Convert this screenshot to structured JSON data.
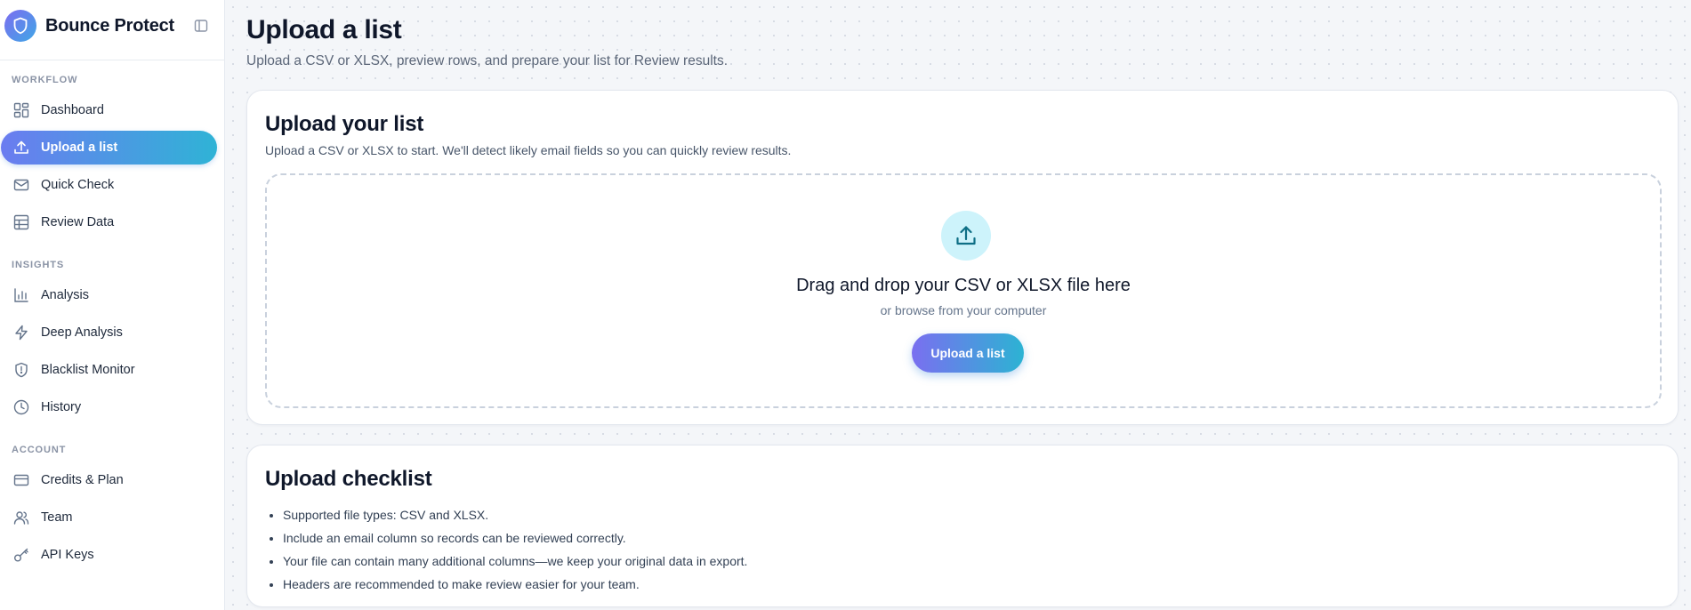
{
  "brand": {
    "name": "Bounce Protect"
  },
  "sidebar": {
    "sections": [
      {
        "label": "WORKFLOW",
        "items": [
          {
            "label": "Dashboard",
            "icon": "dashboard-icon"
          },
          {
            "label": "Upload a list",
            "icon": "upload-icon",
            "active": true
          },
          {
            "label": "Quick Check",
            "icon": "mail-icon"
          },
          {
            "label": "Review Data",
            "icon": "table-icon"
          }
        ]
      },
      {
        "label": "INSIGHTS",
        "items": [
          {
            "label": "Analysis",
            "icon": "bar-chart-icon"
          },
          {
            "label": "Deep Analysis",
            "icon": "lightning-icon"
          },
          {
            "label": "Blacklist Monitor",
            "icon": "shield-alert-icon"
          },
          {
            "label": "History",
            "icon": "clock-icon"
          }
        ]
      },
      {
        "label": "ACCOUNT",
        "items": [
          {
            "label": "Credits & Plan",
            "icon": "credit-card-icon"
          },
          {
            "label": "Team",
            "icon": "users-icon"
          },
          {
            "label": "API Keys",
            "icon": "key-icon"
          }
        ]
      }
    ]
  },
  "page": {
    "title": "Upload a list",
    "subtitle": "Upload a CSV or XLSX, preview rows, and prepare your list for Review results."
  },
  "upload_card": {
    "title": "Upload your list",
    "description": "Upload a CSV or XLSX to start. We'll detect likely email fields so you can quickly review results.",
    "dropzone": {
      "title": "Drag and drop your CSV or XLSX file here",
      "subtitle": "or browse from your computer",
      "button_label": "Upload a list"
    }
  },
  "checklist_card": {
    "title": "Upload checklist",
    "items": [
      "Supported file types: CSV and XLSX.",
      "Include an email column so records can be reviewed correctly.",
      "Your file can contain many additional columns—we keep your original data in export.",
      "Headers are recommended to make review easier for your team."
    ]
  },
  "colors": {
    "accent_start": "#7a6ff0",
    "accent_end": "#2cb3d3",
    "upload_icon_bg": "#cdf3fb"
  }
}
